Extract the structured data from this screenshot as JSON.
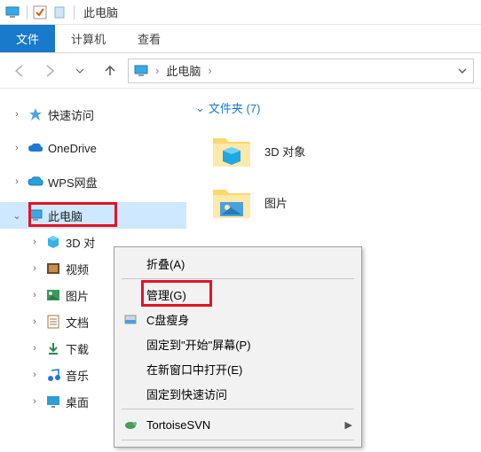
{
  "titlebar": {
    "title": "此电脑"
  },
  "ribbon": {
    "file": "文件",
    "computer": "计算机",
    "view": "查看"
  },
  "breadcrumb": {
    "root": "此电脑"
  },
  "tree": {
    "quick": "快速访问",
    "onedrive": "OneDrive",
    "wps": "WPS网盘",
    "thispc": "此电脑",
    "children": {
      "obj3d": "3D 对",
      "video": "视频",
      "pictures": "图片",
      "documents": "文档",
      "downloads": "下载",
      "music": "音乐",
      "desktop": "桌面"
    }
  },
  "content": {
    "folders_header": "文件夹 (7)",
    "items": {
      "obj3d": "3D 对象",
      "pictures": "图片"
    }
  },
  "ctx": {
    "collapse": "折叠(A)",
    "manage": "管理(G)",
    "cslim": "C盘瘦身",
    "pin_start": "固定到\"开始\"屏幕(P)",
    "new_window": "在新窗口中打开(E)",
    "pin_quick": "固定到快速访问",
    "tortoise": "TortoiseSVN"
  }
}
